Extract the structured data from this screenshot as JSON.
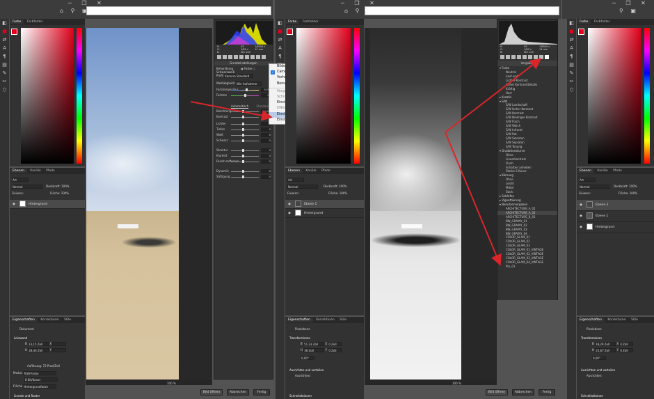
{
  "color_tabs": {
    "color": "Farbe",
    "swatches": "Farbfelder"
  },
  "layer_tabs": {
    "layers": "Ebenen",
    "channels": "Kanäle",
    "paths": "Pfade"
  },
  "layer_controls": {
    "kind": "Art",
    "blend_mode": "Normal",
    "opacity_label": "Deckkraft:",
    "opacity": "100%",
    "lock_label": "Fixieren:",
    "fill_label": "Fläche:",
    "fill": "100%"
  },
  "props_tabs": {
    "properties": "Eigenschaften",
    "adjustments": "Korrekturen",
    "styles": "Stile"
  },
  "left": {
    "layers": [
      {
        "name": "Hintergrund"
      }
    ],
    "props_kind": "Dokument",
    "props_section": "Leinwand",
    "width_label": "B",
    "width": "23,15 Zoll",
    "height_label": "H",
    "height": "28,44 Zoll",
    "x_label": "X",
    "y_label": "Y",
    "resolution": "Auflösung: 72 Pixel/Zoll",
    "mode_label": "Modus",
    "mode": "RGB-Farbe",
    "depth": "8 Bit/Kanal",
    "fill_label": "Fläche",
    "fill_value": "Hintergrundfarbe",
    "guides": "Lineale und Raster"
  },
  "middle": {
    "layers": [
      {
        "name": "Ebene 1"
      },
      {
        "name": "Hintergrund"
      }
    ],
    "props_kind": "Pixelebene",
    "props_section": "Transformieren",
    "w_label": "B",
    "w": "51,33 Zoll",
    "h_label": "H",
    "h": "38 Zoll",
    "x_label": "X",
    "x": "0 Zoll",
    "y_label": "Y",
    "y": "0 Zoll",
    "angle": "0,00°",
    "align": "Ausrichten und verteilen",
    "align_sub": "Ausrichten:",
    "extra": "Schnellaktionen"
  },
  "right": {
    "layers": [
      {
        "name": "Ebene 2"
      },
      {
        "name": "Ebene 1"
      },
      {
        "name": "Hintergrund"
      }
    ],
    "props_kind": "Pixelebene",
    "props_section": "Transformieren",
    "w_label": "B",
    "w": "18,29 Zoll",
    "h_label": "H",
    "h": "21,67 Zoll",
    "x_label": "X",
    "x": "0 Zoll",
    "y_label": "Y",
    "y": "0 Zoll",
    "angle": "0,00°",
    "align": "Ausrichten und verteilen",
    "align_sub": "Ausrichten:",
    "extra": "Schnellaktionen"
  },
  "camera_raw": {
    "readout_left": [
      "R:",
      "G:",
      "B:"
    ],
    "readout_mid": [
      "f/3",
      "1/80 s"
    ],
    "readout_iso": "ISO 100",
    "readout_right": [
      "1/8000 s",
      "14 mm"
    ],
    "section": "Grundeinstellungen",
    "treatment_label": "Behandlung",
    "color_option": "Farbe",
    "bw_option": "Schwarzweiß",
    "profile_label": "Profil",
    "profile": "Kamera Standard",
    "wb_label": "Weißabgleich",
    "wb": "Wie Aufnahme",
    "auto": "Automatisch",
    "default": "Standard",
    "sliders": [
      {
        "label": "Farbtemperatur",
        "val": "5150"
      },
      {
        "label": "Farbton",
        "val": "+3"
      },
      {
        "label": "Belichtung",
        "val": "0,00"
      },
      {
        "label": "Kontrast",
        "val": "0"
      },
      {
        "label": "Lichter",
        "val": "0"
      },
      {
        "label": "Tiefen",
        "val": "0"
      },
      {
        "label": "Weiß",
        "val": "0"
      },
      {
        "label": "Schwarz",
        "val": "0"
      },
      {
        "label": "Struktur",
        "val": "0"
      },
      {
        "label": "Klarheit",
        "val": "0"
      },
      {
        "label": "Dunst entfernen",
        "val": "0"
      },
      {
        "label": "Dynamik",
        "val": "0"
      },
      {
        "label": "Sättigung",
        "val": "0"
      }
    ]
  },
  "menu": {
    "items": [
      {
        "label": "Bildeinstellungen",
        "state": ""
      },
      {
        "label": "Camera Raw-Standards",
        "state": "checked"
      },
      {
        "label": "Vorherige Konvertierung",
        "state": ""
      },
      {
        "label": "Benutzerdefinierte Einstellungen",
        "state": ""
      },
      {
        "label": "Vorgabe-Favoriten anwenden",
        "state": "dis"
      },
      {
        "label": "Schnappschuss anwenden",
        "state": "dis"
      },
      {
        "label": "Einstellungen in XMP exportieren",
        "state": ""
      },
      {
        "label": "DNG-Vorschauen aktualisieren",
        "state": "dis"
      },
      {
        "label": "Einstellungen laden...",
        "state": "hl"
      },
      {
        "label": "Einstellungen speichern...",
        "state": ""
      }
    ]
  },
  "presets": {
    "header": "Vorgaben",
    "groups": [
      {
        "name": "Farbe",
        "items": [
          "Neutral",
          "Lauf und",
          "Lichter-Kontrast",
          "Hoher Kontrast/Details",
          "Kräftig",
          "Hart"
        ]
      },
      {
        "name": "Kreativ",
        "items": []
      },
      {
        "name": "S/W",
        "items": [
          "S/W Landschaft",
          "S/W Hoher Kontrast",
          "S/W Kontrast",
          "S/W Niedriger Kontrast",
          "S/W Flach",
          "S/W Weich",
          "S/W Infrarot",
          "S/W Rot",
          "S/W Selenton",
          "S/W Sepiaton",
          "S/W Tonung"
        ]
      },
      {
        "name": "Gradationskurve",
        "items": [
          "Ohne",
          "Linearkontrast",
          "Flach",
          "Schatten anheben",
          "Starke S-Kurve"
        ]
      },
      {
        "name": "Körnung",
        "items": [
          "Ohne",
          "Leicht",
          "Mittel",
          "Stark"
        ]
      },
      {
        "name": "Schärfen",
        "items": []
      },
      {
        "name": "Vignettierung",
        "items": []
      },
      {
        "name": "Benutzervorgaben",
        "items": [
          "ARCHITECTURE_A_01",
          "ARCHITECTURE_A_02",
          "ARCHITECTURE_B_01",
          "BW_GRAINY_01",
          "BW_GRAINY_02",
          "BW_GRAINY_03",
          "BW_GRAINY_04",
          "COLOR_GLAM_01",
          "COLOR_GLAM_02",
          "COLOR_GLAM_03",
          "COLOR_GLAM_01_VINTAGE",
          "COLOR_GLAM_02_VINTAGE",
          "COLOR_GLAM_03_VINTAGE",
          "COLOR_GLAM_04_VINTAGE",
          "Pro_01"
        ]
      }
    ]
  },
  "bottom": {
    "zoom": "100 %",
    "open": "Bild öffnen",
    "cancel": "Abbrechen",
    "done": "Fertig"
  },
  "colors": {
    "arrow": "#d9262b",
    "accent": "#e2001a",
    "highlight": "#b8cce8"
  }
}
